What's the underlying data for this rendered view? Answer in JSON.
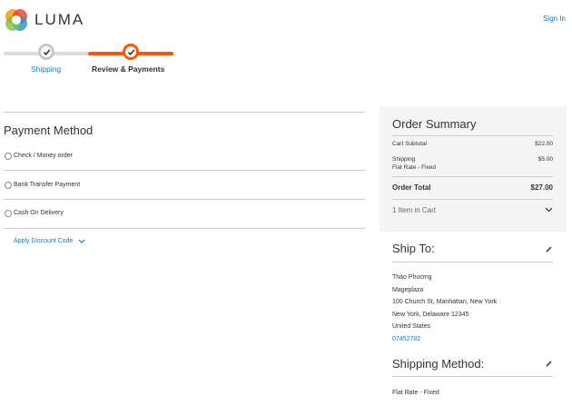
{
  "header": {
    "logo_text": "LUMA",
    "sign_in": "Sign In"
  },
  "progress": {
    "steps": [
      {
        "label": "Shipping",
        "state": "complete"
      },
      {
        "label": "Review & Payments",
        "state": "active"
      }
    ]
  },
  "payment": {
    "title": "Payment Method",
    "options": [
      {
        "label": "Check / Money order",
        "selected": false
      },
      {
        "label": "Bank Transfer Payment",
        "selected": false
      },
      {
        "label": "Cash On Delivery",
        "selected": false
      }
    ],
    "discount_label": "Apply Discount Code"
  },
  "summary": {
    "title": "Order Summary",
    "cart_subtotal_label": "Cart Subtotal",
    "cart_subtotal_value": "$22.00",
    "shipping_label": "Shipping",
    "shipping_method": "Flat Rate - Fixed",
    "shipping_value": "$5.00",
    "order_total_label": "Order Total",
    "order_total_value": "$27.00",
    "items_in_cart": "1 Item in Cart"
  },
  "ship_to": {
    "title": "Ship To:",
    "name": "Thảo Phương",
    "company": "Mageplaza",
    "street": "100 Church St, Manhattan, New York",
    "city_line": "New York, Delaware 12345",
    "country": "United States",
    "phone": "07452782"
  },
  "shipping_method": {
    "title": "Shipping Method:",
    "value": "Flat Rate - Fixed"
  },
  "colors": {
    "accent": "#ff5501",
    "link": "#1979c3",
    "summary_bg": "#f5f5f5"
  }
}
